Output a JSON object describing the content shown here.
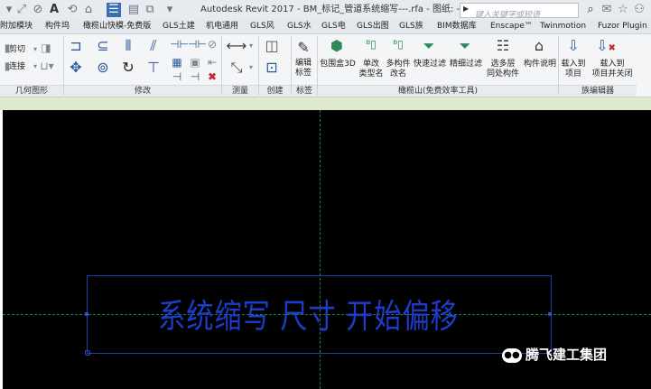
{
  "titlebar": {
    "title": "Autodesk Revit 2017 -   BM_标记_管道系统缩写---.rfa - 图纸: -",
    "search_placeholder": "键入关键字或短语"
  },
  "tabs": [
    "附加模块",
    "构件坞",
    "橄榄山快模-免费版",
    "GLS土建",
    "机电通用",
    "GLS风",
    "GLS水",
    "GLS电",
    "GLS出图",
    "GLS族",
    "BIM数据库",
    "Enscape™",
    "Twinmotion",
    "Fuzor Plugin"
  ],
  "ribbon": {
    "geometry": {
      "cut_label": "剪切",
      "join_label": "连接",
      "panel_label": "几何图形"
    },
    "modify": {
      "panel_label": "修改"
    },
    "measure": {
      "panel_label": "测量"
    },
    "create": {
      "panel_label": "创建"
    },
    "label_panel": {
      "edit_label_line1": "编辑",
      "edit_label_line2": "标签",
      "panel_label": "标签"
    },
    "gls": {
      "panel_label": "橄榄山(免费效率工具)",
      "buttons": [
        {
          "l1": "包围盒3D",
          "l2": ""
        },
        {
          "l1": "单改",
          "l2": "类型名"
        },
        {
          "l1": "多构件",
          "l2": "改名"
        },
        {
          "l1": "快速过滤",
          "l2": ""
        },
        {
          "l1": "精细过滤",
          "l2": ""
        },
        {
          "l1": "选多层",
          "l2": "同处构件"
        },
        {
          "l1": "构件说明",
          "l2": ""
        }
      ]
    },
    "family_editor": {
      "panel_label": "族编辑器",
      "load_l1": "载入到",
      "load_l2": "项目",
      "load_close_l1": "载入到",
      "load_close_l2": "项目并关闭"
    }
  },
  "canvas": {
    "tag_text": "系统缩写 尺寸 开始偏移",
    "watermark": "腾飞建工集团"
  },
  "colors": {
    "tag_blue": "#1d3cc8",
    "canvas_bg": "#000000",
    "ref_line": "#1f7a4a"
  }
}
